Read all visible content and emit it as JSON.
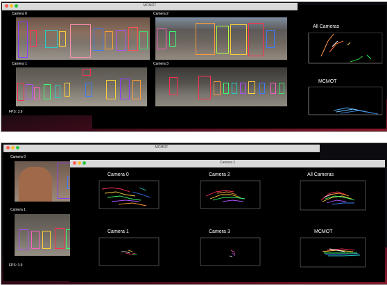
{
  "top_screenshot": {
    "window": {
      "title": "MCMOT",
      "camera_labels": [
        "Camera 0",
        "Camera 2",
        "Camera 1",
        "Camera 3"
      ],
      "fps": "FPS: 3.9"
    },
    "plots": {
      "all_title": "All Cameras",
      "mcmot_title": "MCMOT"
    }
  },
  "bottom_screenshot": {
    "back_window": {
      "title": "MCMOT",
      "camera_labels": [
        "Camera 0",
        "Camera 1"
      ],
      "fps": "FPS: 3.9"
    },
    "front_window": {
      "title": "Camera 2",
      "plot_titles": [
        "Camera 0",
        "Camera 2",
        "All Cameras",
        "Camera 1",
        "Camera 3",
        "MCMOT"
      ]
    }
  },
  "colors": {
    "desktop_dark": "#0c0c10",
    "desktop_red": "#7a1426",
    "window_black": "#000000"
  }
}
